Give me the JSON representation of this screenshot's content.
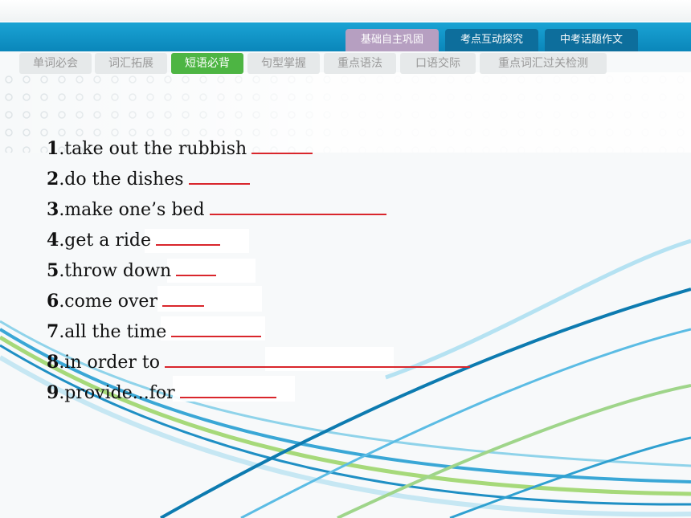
{
  "top_tabs": [
    {
      "label": "基础自主巩固",
      "active": true
    },
    {
      "label": "考点互动探究",
      "active": false
    },
    {
      "label": "中考话题作文",
      "active": false
    }
  ],
  "sub_tabs": [
    {
      "label": "单词必会",
      "active": false
    },
    {
      "label": "词汇拓展",
      "active": false
    },
    {
      "label": "短语必背",
      "active": true
    },
    {
      "label": "句型掌握",
      "active": false
    },
    {
      "label": "重点语法",
      "active": false
    },
    {
      "label": "口语交际",
      "active": false
    },
    {
      "label": "重点词汇过关检测",
      "active": false
    }
  ],
  "items": [
    {
      "num": "1",
      "text": ".take out the rubbish"
    },
    {
      "num": "2",
      "text": ".do the dishes"
    },
    {
      "num": "3",
      "text": ".make one’s bed"
    },
    {
      "num": "4",
      "text": ".get a ride"
    },
    {
      "num": "5",
      "text": ".throw down"
    },
    {
      "num": "6",
      "text": ".come over"
    },
    {
      "num": "7",
      "text": ".all the time"
    },
    {
      "num": "8",
      "text": ".in order to"
    },
    {
      "num": "9",
      "text": ".provide...for"
    }
  ],
  "colors": {
    "accent_blue": "#0a86ba",
    "active_green": "#4db543",
    "answer_red": "#d9262c"
  }
}
